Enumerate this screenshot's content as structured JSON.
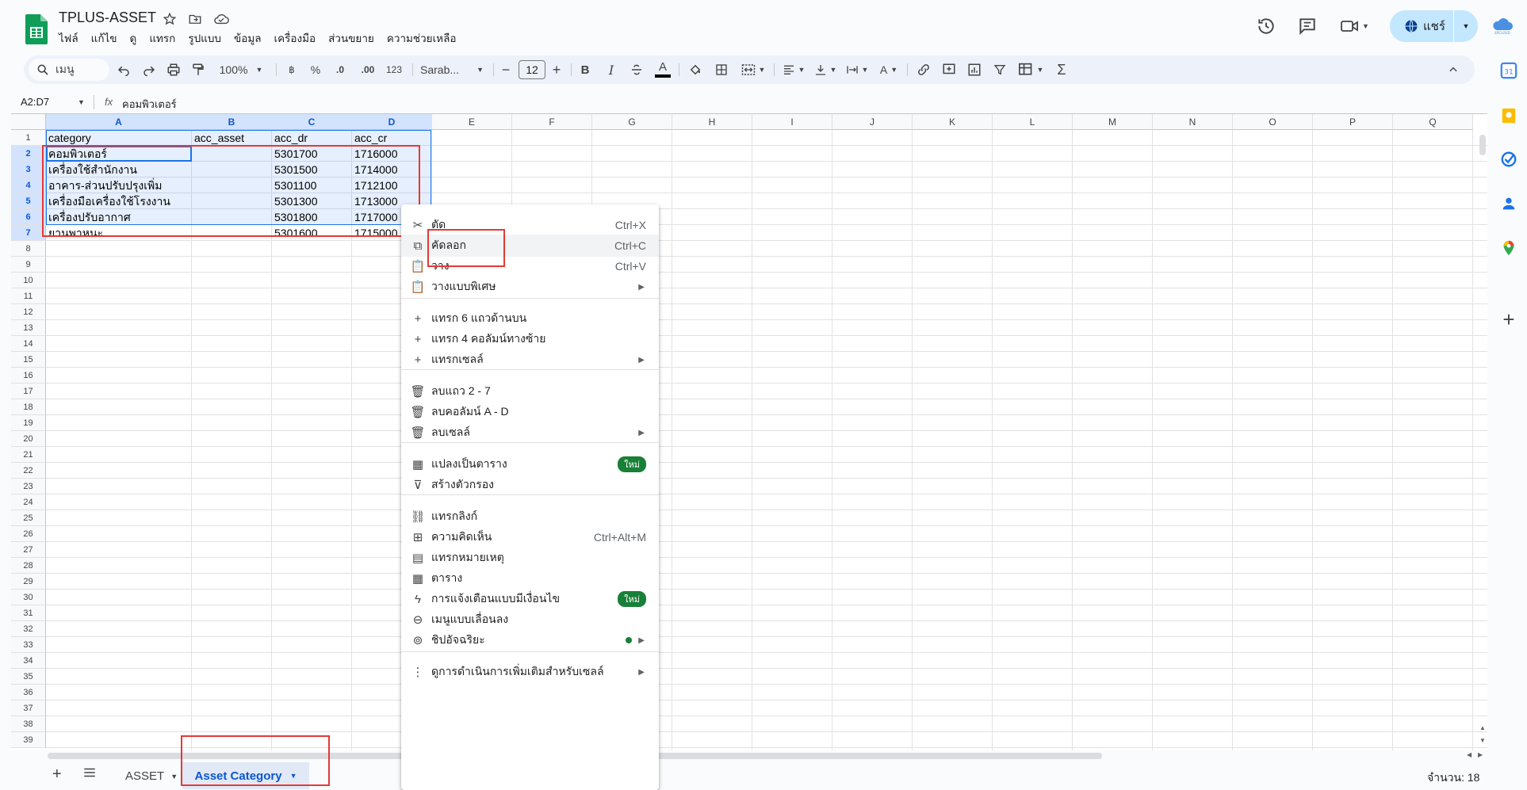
{
  "app": {
    "title": "TPLUS-ASSET",
    "menus": [
      "ไฟล์",
      "แก้ไข",
      "ดู",
      "แทรก",
      "รูปแบบ",
      "ข้อมูล",
      "เครื่องมือ",
      "ส่วนขยาย",
      "ความช่วยเหลือ"
    ],
    "share_label": "แชร์",
    "accent": "#0b57d0"
  },
  "toolbar": {
    "search_label": "เมนู",
    "zoom": "100%",
    "currency": "฿",
    "percent": "%",
    "dec_decrease": ".0",
    "dec_increase": ".00",
    "number_format": "123",
    "font": "Sarab...",
    "font_size": "12"
  },
  "formula_bar": {
    "name_box": "A2:D7",
    "fx": "fx",
    "value": "คอมพิวเตอร์"
  },
  "grid": {
    "columns": [
      "A",
      "B",
      "C",
      "D",
      "E",
      "F",
      "G",
      "H",
      "I",
      "J",
      "K",
      "L",
      "M",
      "N",
      "O",
      "P",
      "Q"
    ],
    "rows": [
      "1",
      "2",
      "3",
      "4",
      "5",
      "6",
      "7",
      "8",
      "9",
      "10",
      "11",
      "12",
      "13",
      "14",
      "15",
      "16",
      "17",
      "18",
      "19",
      "20",
      "21",
      "22",
      "23",
      "24",
      "25",
      "26",
      "27",
      "28",
      "29",
      "30",
      "31",
      "32",
      "33",
      "34",
      "35",
      "36",
      "37",
      "38",
      "39"
    ],
    "headers": [
      "category",
      "acc_asset",
      "acc_dr",
      "acc_cr"
    ],
    "data": [
      [
        "คอมพิวเตอร์",
        "",
        "5301700",
        "1716000"
      ],
      [
        "เครื่องใช้สำนักงาน",
        "",
        "5301500",
        "1714000"
      ],
      [
        "อาคาร-ส่วนปรับปรุงเพิ่ม",
        "",
        "5301100",
        "1712100"
      ],
      [
        "เครื่องมือเครื่องใช้โรงงาน",
        "",
        "5301300",
        "1713000"
      ],
      [
        "เครื่องปรับอากาศ",
        "",
        "5301800",
        "1717000"
      ],
      [
        "ยานพาหนะ",
        "",
        "5301600",
        "1715000"
      ]
    ]
  },
  "context_menu": {
    "items": [
      {
        "icon": "scissors-icon",
        "label": "ตัด",
        "shortcut": "Ctrl+X"
      },
      {
        "icon": "copy-icon",
        "label": "คัดลอก",
        "shortcut": "Ctrl+C"
      },
      {
        "icon": "paste-icon",
        "label": "วาง",
        "shortcut": "Ctrl+V"
      },
      {
        "icon": "paste-special-icon",
        "label": "วางแบบพิเศษ",
        "submenu": true
      },
      {
        "icon": "plus-icon",
        "label": "แทรก 6 แถวด้านบน"
      },
      {
        "icon": "plus-icon",
        "label": "แทรก 4 คอลัมน์ทางซ้าย"
      },
      {
        "icon": "plus-icon",
        "label": "แทรกเซลล์",
        "submenu": true
      },
      {
        "icon": "trash-icon",
        "label": "ลบแถว 2 - 7"
      },
      {
        "icon": "trash-icon",
        "label": "ลบคอลัมน์ A - D"
      },
      {
        "icon": "trash-icon",
        "label": "ลบเซลล์",
        "submenu": true
      },
      {
        "icon": "table-icon",
        "label": "แปลงเป็นตาราง",
        "badge": "ใหม่"
      },
      {
        "icon": "filter-icon",
        "label": "สร้างตัวกรอง"
      },
      {
        "icon": "link-icon",
        "label": "แทรกลิงก์"
      },
      {
        "icon": "comment-icon",
        "label": "ความคิดเห็น",
        "shortcut": "Ctrl+Alt+M"
      },
      {
        "icon": "note-icon",
        "label": "แทรกหมายเหตุ"
      },
      {
        "icon": "table-icon",
        "label": "ตาราง"
      },
      {
        "icon": "bolt-icon",
        "label": "การแจ้งเตือนแบบมีเงื่อนไข",
        "badge": "ใหม่"
      },
      {
        "icon": "dropdown-icon",
        "label": "เมนูแบบเลื่อนลง"
      },
      {
        "icon": "smart-chip-icon",
        "label": "ชิปอัจฉริยะ",
        "submenu": true
      },
      {
        "icon": "more-vert-icon",
        "label": "ดูการดำเนินการเพิ่มเติมสำหรับเซลล์",
        "submenu": true
      }
    ]
  },
  "sheets": {
    "tabs": [
      "ASSET",
      "Asset Category"
    ],
    "active": "Asset Category",
    "count_label": "จำนวน: 18"
  }
}
